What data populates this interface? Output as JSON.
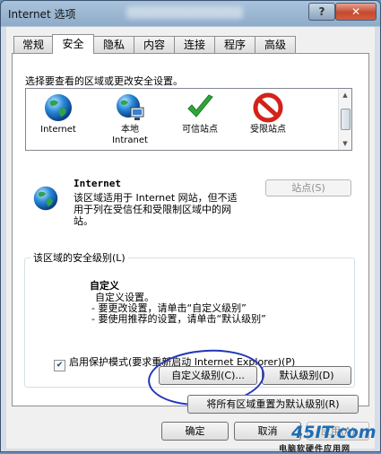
{
  "window": {
    "title": "Internet 选项",
    "help_label": "?",
    "close_label": "✕"
  },
  "tabs": [
    {
      "label": "常规"
    },
    {
      "label": "安全"
    },
    {
      "label": "隐私"
    },
    {
      "label": "内容"
    },
    {
      "label": "连接"
    },
    {
      "label": "程序"
    },
    {
      "label": "高级"
    }
  ],
  "active_tab": "安全",
  "security": {
    "instruction": "选择要查看的区域或更改安全设置。",
    "zones": [
      {
        "label": "Internet",
        "icon": "globe-icon"
      },
      {
        "label": "本地",
        "label2": "Intranet",
        "icon": "intranet-icon"
      },
      {
        "label": "可信站点",
        "icon": "checkmark-icon"
      },
      {
        "label": "受限站点",
        "icon": "restricted-icon"
      }
    ],
    "selected_zone": {
      "name": "Internet",
      "description": "该区域适用于 Internet 网站，但不适用于列在受信任和受限制区域中的网站。"
    },
    "sites_button": "站点(S)",
    "level_group_label": "该区域的安全级别(L)",
    "level": {
      "title": "自定义",
      "line1": "自定义设置。",
      "line2": "- 要更改设置，请单击“自定义级别”",
      "line3": "- 要使用推荐的设置，请单击“默认级别”"
    },
    "protected_mode": {
      "label": "启用保护模式(要求重新启动 Internet Explorer)(P)",
      "checked": true,
      "check_glyph": "✔"
    },
    "custom_level_button": "自定义级别(C)...",
    "default_level_button": "默认级别(D)",
    "reset_all_button": "将所有区域重置为默认级别(R)"
  },
  "footer": {
    "ok": "确定",
    "cancel": "取消",
    "apply": "应用(A)"
  },
  "watermark": {
    "logo": "45IT.com",
    "subtitle": "电脑软硬件应用网"
  },
  "colors": {
    "annotation_circle": "#2236b8",
    "title_bar": "#8eabc8",
    "close_button": "#c44a2f"
  }
}
